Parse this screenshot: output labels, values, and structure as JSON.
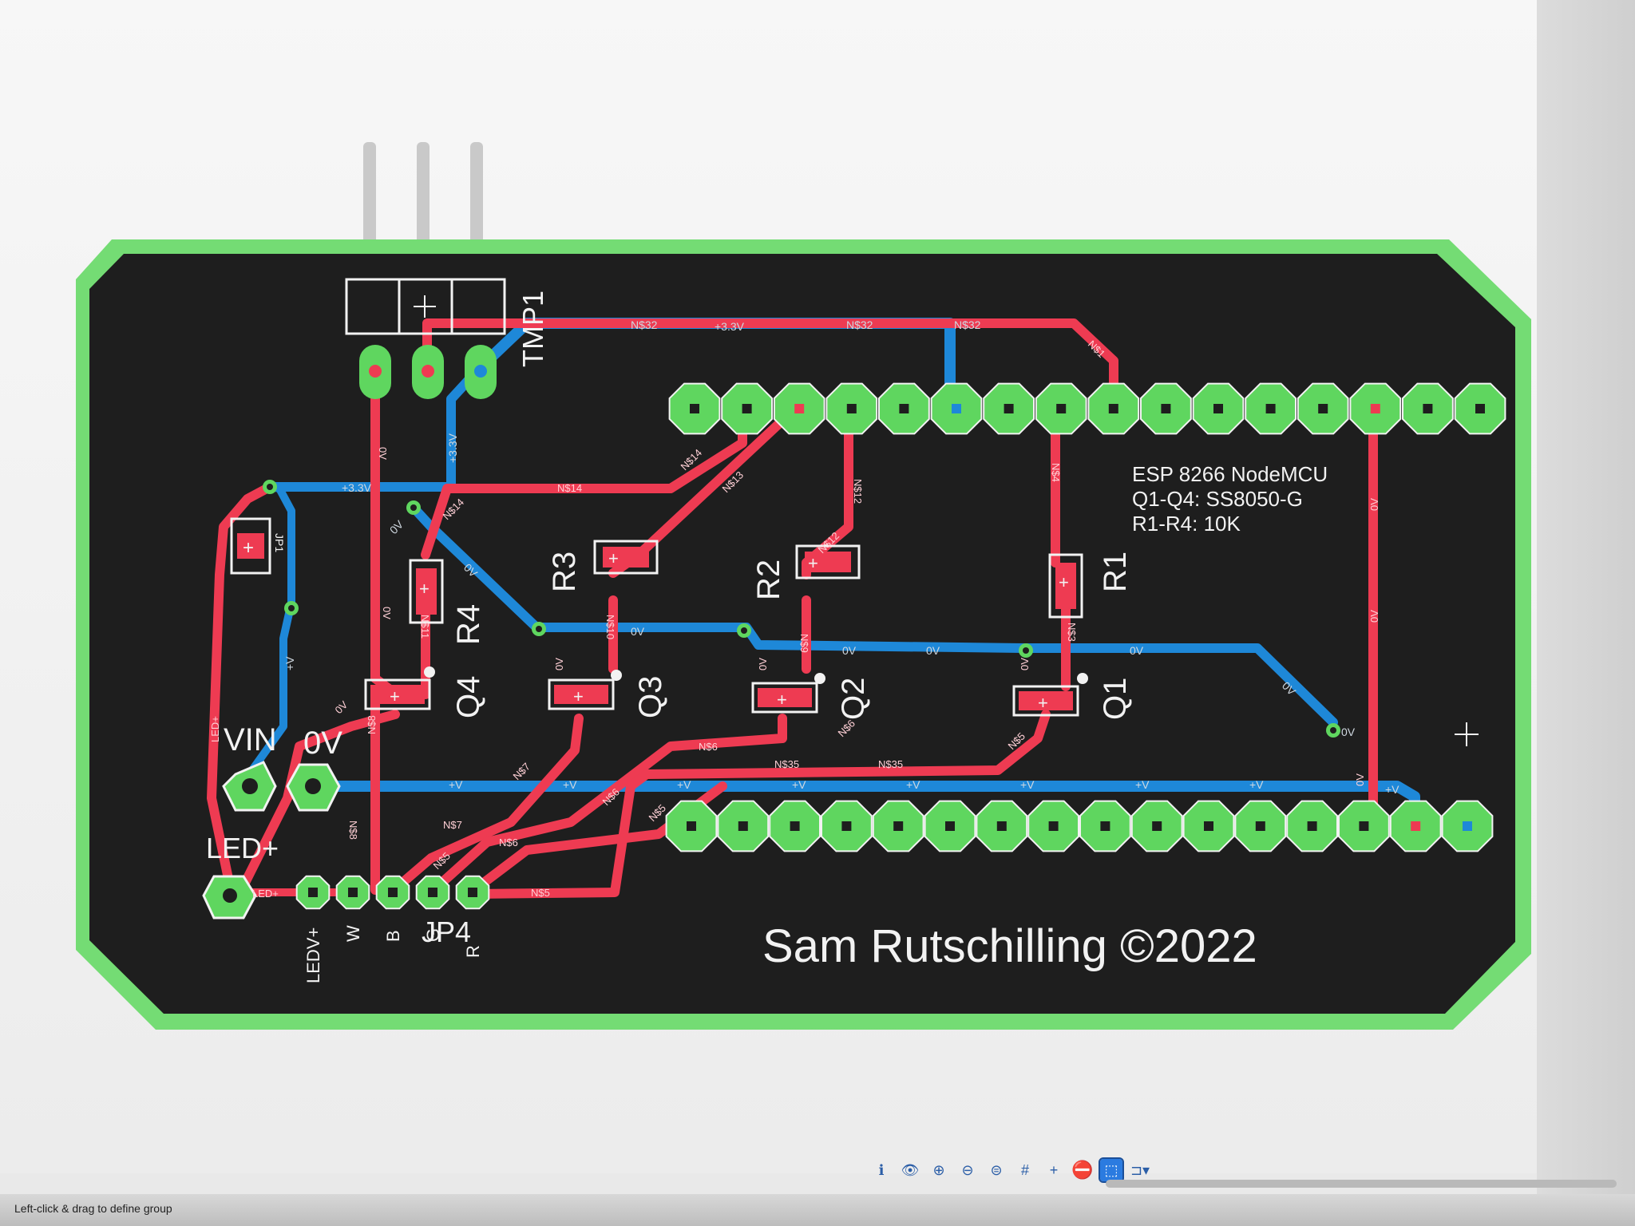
{
  "board": {
    "colors": {
      "outline": "#5fd65f",
      "substrate": "#1e1e1e",
      "top_copper": "#ee3b52",
      "bottom_copper": "#1e88d8",
      "pad": "#5fd65f",
      "silk": "#f2f2f2"
    },
    "silkscreen": {
      "tmp1": "TMP1",
      "r1": "R1",
      "r2": "R2",
      "r3": "R3",
      "r4": "R4",
      "q1": "Q1",
      "q2": "Q2",
      "q3": "Q3",
      "q4": "Q4",
      "vin": "VIN",
      "gnd": "0V",
      "ledplus": "LED+",
      "jp4": "JP4",
      "jp4_pin_ledv": "LEDV+",
      "jp4_pin_w": "W",
      "jp4_pin_b": "B",
      "jp4_pin_g": "G",
      "jp4_pin_r": "R",
      "jp1": "JP1",
      "notes": [
        "ESP 8266 NodeMCU",
        "Q1-Q4: SS8050-G",
        "R1-R4: 10K"
      ],
      "credit": "Sam Rutschilling ©2022"
    },
    "trace_labels": {
      "n32a": "N$32",
      "n32b": "N$32",
      "n32c": "N$32",
      "v33_top": "+3.3V",
      "v33_vertical": "+3.3V",
      "v33_left": "+3.3V",
      "n14": "N$14",
      "n14b": "N$14",
      "n14c": "N$14",
      "n13": "N$13",
      "n12": "N$12",
      "n12b": "N$12",
      "n4": "N$4",
      "n3": "N$3",
      "n1": "N$1",
      "ov_diag": "0V",
      "ov_diag2": "0V",
      "ov_vert": "0V",
      "ov_vert2": "0V",
      "ov_h1": "0V",
      "ov_h2": "0V",
      "ov_h3": "0V",
      "ov_h4": "0V",
      "ov_diag3": "0V",
      "ov_end": "0V",
      "ov_right1": "0V",
      "ov_right2": "0V",
      "ov_right3": "0V",
      "ov_q4": "0V",
      "ov_q3": "0V",
      "ov_q2": "0V",
      "ov_q1": "0V",
      "v_plus": "+V",
      "ledplus_trace": "LED+",
      "ledplus_trace2": "LED+",
      "n10": "N$10",
      "n11": "N$11",
      "n9": "N$9",
      "n2": "N$2",
      "n8": "N$8",
      "n8b": "N$8",
      "n7": "N$7",
      "n7b": "N$7",
      "n6": "N$6",
      "n6b": "N$6",
      "n6c": "N$6",
      "n6d": "N$6",
      "n5": "N$5",
      "n5b": "N$5",
      "n5c": "N$5",
      "n5d": "N$5",
      "n35": "N$35",
      "n35b": "N$35"
    }
  },
  "toolbar": {
    "buttons": [
      {
        "name": "info-icon",
        "glyph": "ℹ"
      },
      {
        "name": "eye-icon",
        "glyph": "👁"
      },
      {
        "name": "zoom-in-icon",
        "glyph": "⊕"
      },
      {
        "name": "zoom-out-icon",
        "glyph": "⊖"
      },
      {
        "name": "zoom-fit-icon",
        "glyph": "⊜"
      },
      {
        "name": "grid-icon",
        "glyph": "#"
      },
      {
        "name": "crosshair-icon",
        "glyph": "+"
      },
      {
        "name": "stop-icon",
        "glyph": "⛔"
      },
      {
        "name": "select-icon",
        "glyph": "⬚"
      },
      {
        "name": "route-dropdown-icon",
        "glyph": "⊐▾"
      }
    ]
  },
  "status": {
    "text": "Left-click & drag to define group"
  }
}
